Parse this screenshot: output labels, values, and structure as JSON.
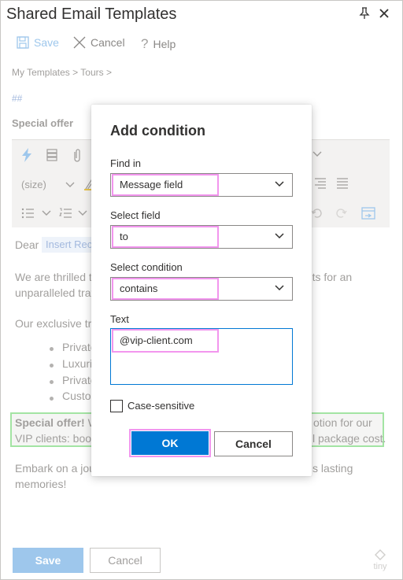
{
  "panel": {
    "title": "Shared Email Templates",
    "pin_icon": "pin-icon",
    "close_icon": "close-icon"
  },
  "toolbar": {
    "save_label": "Save",
    "cancel_label": "Cancel",
    "help_label": "Help"
  },
  "breadcrumb": "My Templates > Tours >",
  "hashes": "##",
  "template_name": "Special offer",
  "editor": {
    "font_size": "(size)"
  },
  "body": {
    "greeting": "Dear",
    "insert_chip": "Insert Rec",
    "para1_line1_left": "We are thrilled t",
    "para1_line1_right": "ents for an",
    "para1_line2": "unparalleled trav",
    "para2": "Our exclusive tra",
    "list": [
      "Private",
      "Luxuri",
      "Private",
      "Custo"
    ],
    "offer_bold": "Special offer!",
    "offer_line1_mid": "W",
    "offer_line1_right": "otion for our",
    "offer_line2_left": "VIP clients: book",
    "offer_line2_right": "l package cost.",
    "closing_line1_left": "Embark on a jou",
    "closing_line1_right": "s lasting",
    "closing_line2": "memories!"
  },
  "footer": {
    "save_label": "Save",
    "cancel_label": "Cancel",
    "logo_text": "tiny"
  },
  "dialog": {
    "title": "Add condition",
    "find_in_label": "Find in",
    "find_in_value": "Message field",
    "select_field_label": "Select field",
    "select_field_value": "to",
    "select_condition_label": "Select condition",
    "select_condition_value": "contains",
    "text_label": "Text",
    "text_value": "@vip-client.com",
    "case_sensitive_label": "Case-sensitive",
    "case_sensitive_checked": false,
    "ok_label": "OK",
    "cancel_label": "Cancel"
  },
  "colors": {
    "accent": "#0078d4",
    "highlight_outline": "#f296ee",
    "offer_outline": "#a3e4a3"
  }
}
